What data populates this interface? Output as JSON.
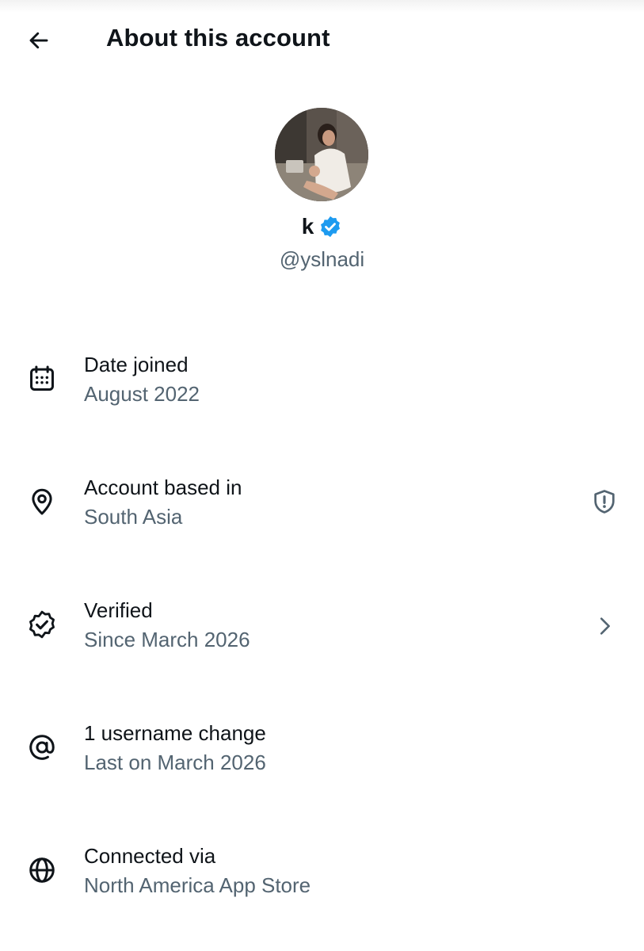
{
  "header": {
    "title": "About this account",
    "back_icon": "arrow-left-icon"
  },
  "profile": {
    "display_name": "k",
    "handle": "@yslnadi",
    "verified_badge_color": "#1d9bf0",
    "verified_icon": "verified-badge-icon"
  },
  "colors": {
    "primary_text": "#0f1419",
    "secondary_text": "#536471"
  },
  "rows": [
    {
      "icon": "calendar-icon",
      "title": "Date joined",
      "subtitle": "August 2022"
    },
    {
      "icon": "location-pin-icon",
      "title": "Account based in",
      "subtitle": "South Asia",
      "trailing_icon": "shield-alert-icon"
    },
    {
      "icon": "verified-outline-icon",
      "title": "Verified",
      "subtitle": "Since March 2026",
      "trailing_icon": "chevron-right-icon"
    },
    {
      "icon": "at-sign-icon",
      "title": "1 username change",
      "subtitle": "Last on March 2026"
    },
    {
      "icon": "globe-icon",
      "title": "Connected via",
      "subtitle": "North America App Store"
    }
  ]
}
